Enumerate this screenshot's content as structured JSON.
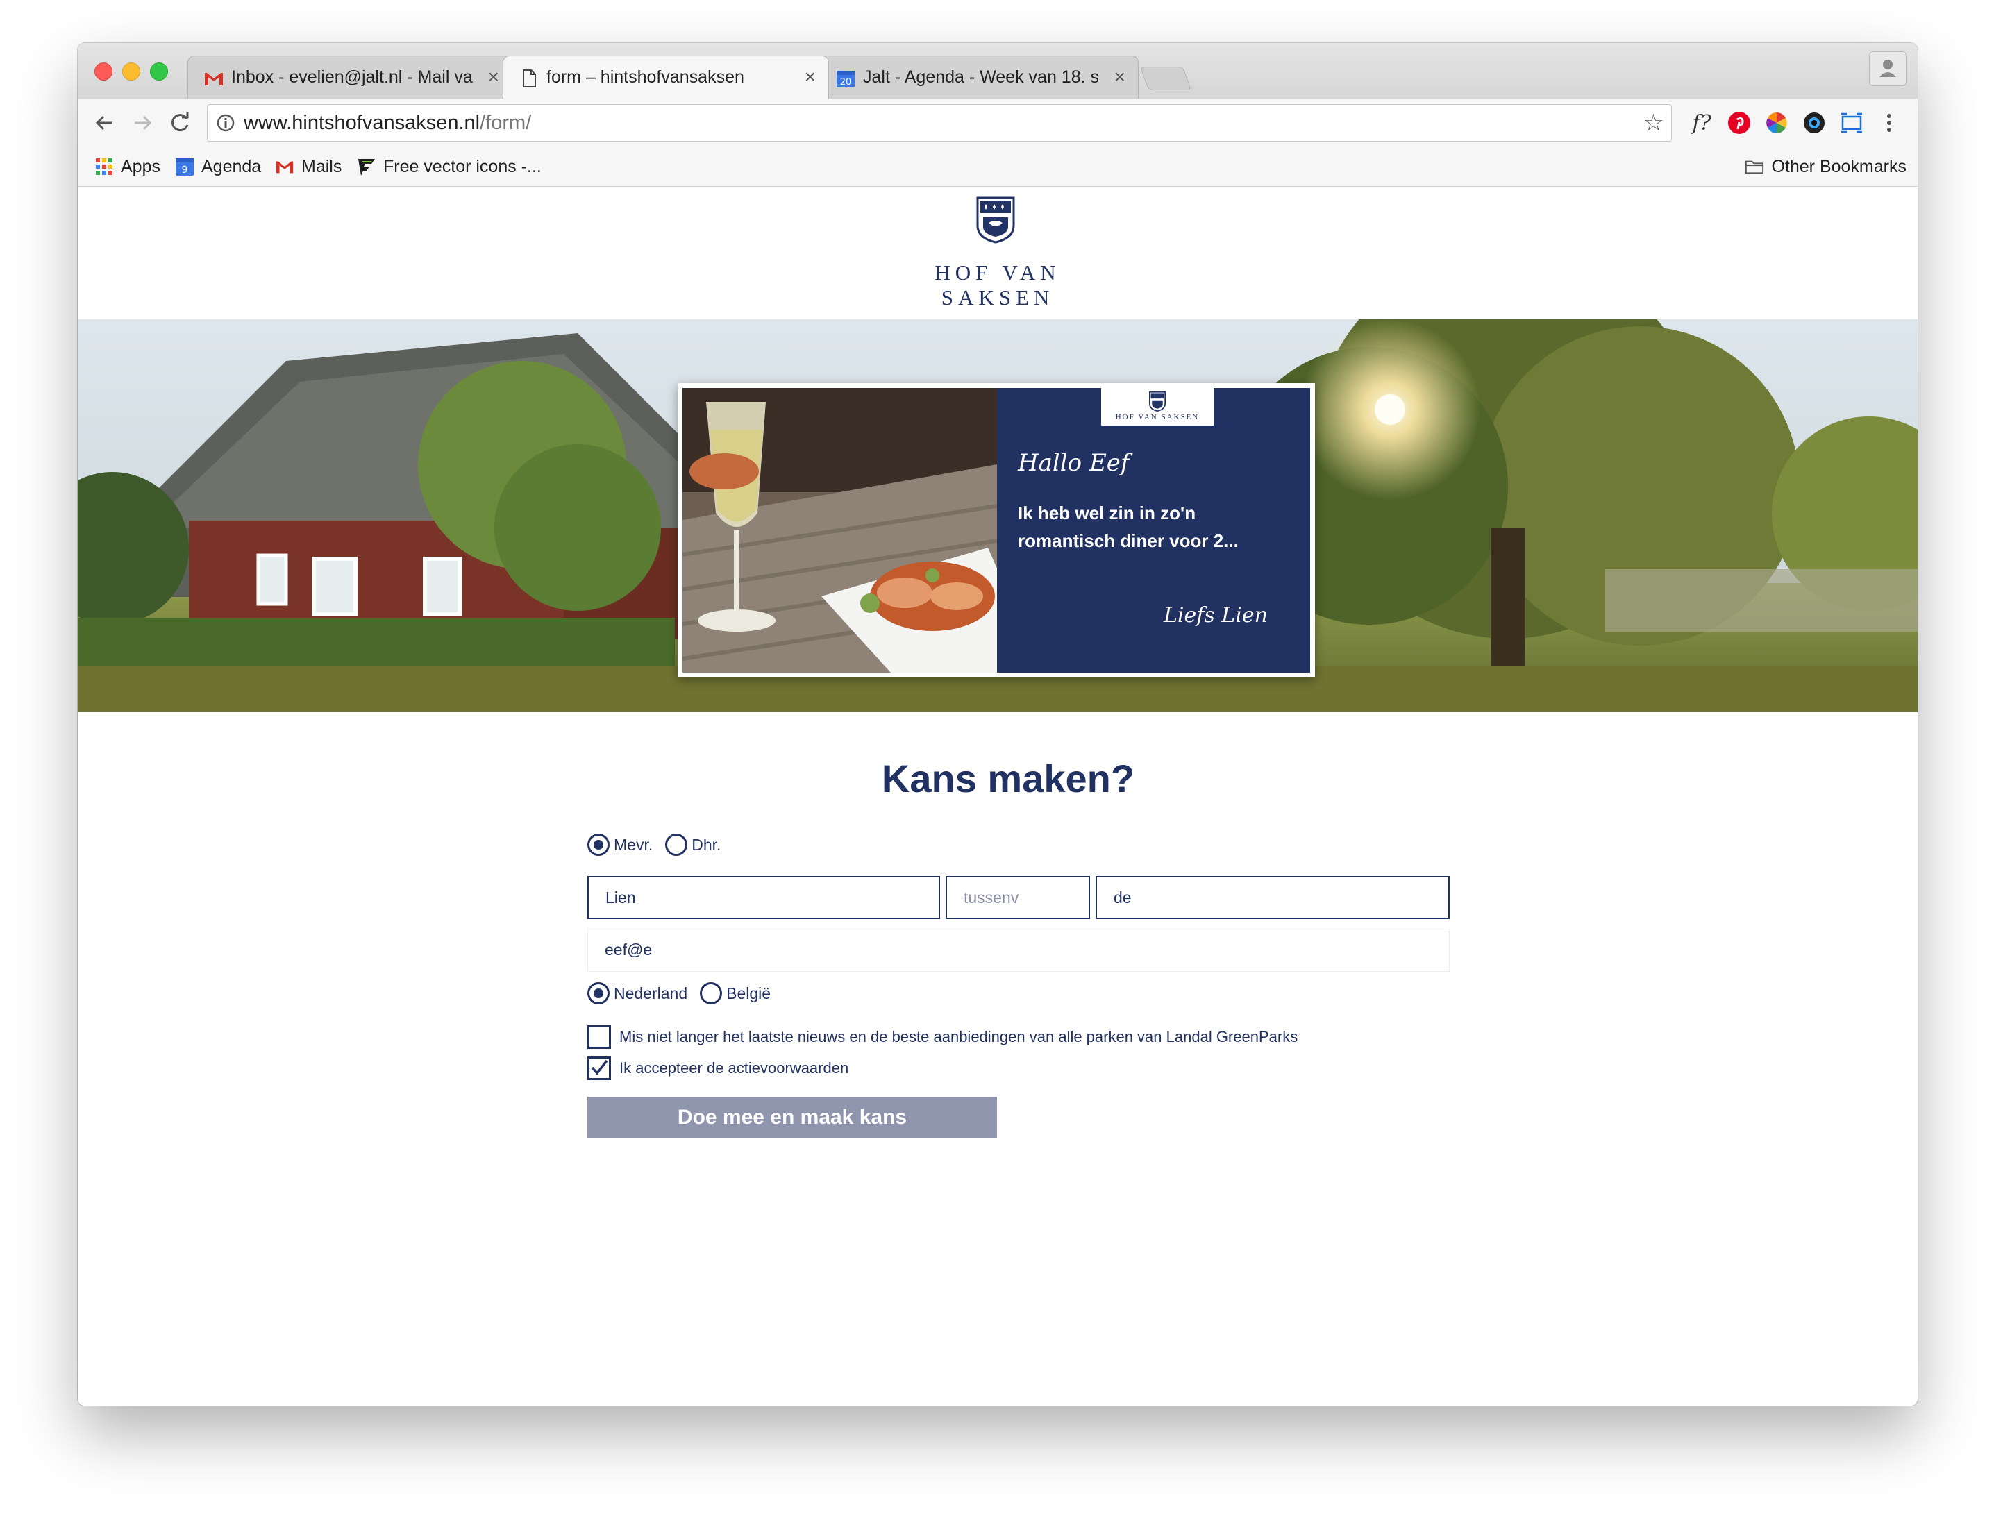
{
  "browser": {
    "tabs": [
      {
        "title": "Inbox - evelien@jalt.nl - Mail va",
        "icon": "gmail-icon",
        "active": false
      },
      {
        "title": "form – hintshofvansaksen",
        "icon": "page-icon",
        "active": true
      },
      {
        "title": "Jalt - Agenda - Week van 18. s",
        "icon": "calendar-icon",
        "calendar_day": "20",
        "active": false
      }
    ],
    "tab_close_glyph": "×",
    "url": {
      "host": "www.hintshofvansaksen.nl",
      "path": "/form/"
    },
    "bookmarks": [
      {
        "label": "Apps",
        "icon": "apps-grid-icon"
      },
      {
        "label": "Agenda",
        "icon": "calendar-icon",
        "calendar_day": "9"
      },
      {
        "label": "Mails",
        "icon": "gmail-icon"
      },
      {
        "label": "Free vector icons -...",
        "icon": "flaticon-icon"
      }
    ],
    "other_bookmarks": "Other Bookmarks",
    "extension_f_label": "f?",
    "star_glyph": "☆"
  },
  "site": {
    "brand": "HOF VAN SAKSEN",
    "card": {
      "greeting": "Hallo Eef",
      "message": "Ik heb wel zin in zo'n romantisch diner voor 2...",
      "signoff": "Liefs Lien",
      "panel_color": "#213262"
    }
  },
  "form": {
    "title": "Kans maken?",
    "salutation": [
      {
        "label": "Mevr.",
        "checked": true
      },
      {
        "label": "Dhr.",
        "checked": false
      }
    ],
    "first_name": {
      "value": "Lien"
    },
    "middle_name": {
      "value": "",
      "placeholder": "tussenv"
    },
    "last_name": {
      "value": "de"
    },
    "email": {
      "value": "eef@e"
    },
    "country": [
      {
        "label": "Nederland",
        "checked": true
      },
      {
        "label": "België",
        "checked": false
      }
    ],
    "newsletter": {
      "label": "Mis niet langer het laatste nieuws en de beste aanbiedingen van alle parken van Landal GreenParks",
      "checked": false
    },
    "terms": {
      "label": "Ik accepteer de actievoorwaarden",
      "checked": true
    },
    "submit_label": "Doe mee en maak kans",
    "colors": {
      "accent": "#213262",
      "button": "#9095ae"
    }
  }
}
